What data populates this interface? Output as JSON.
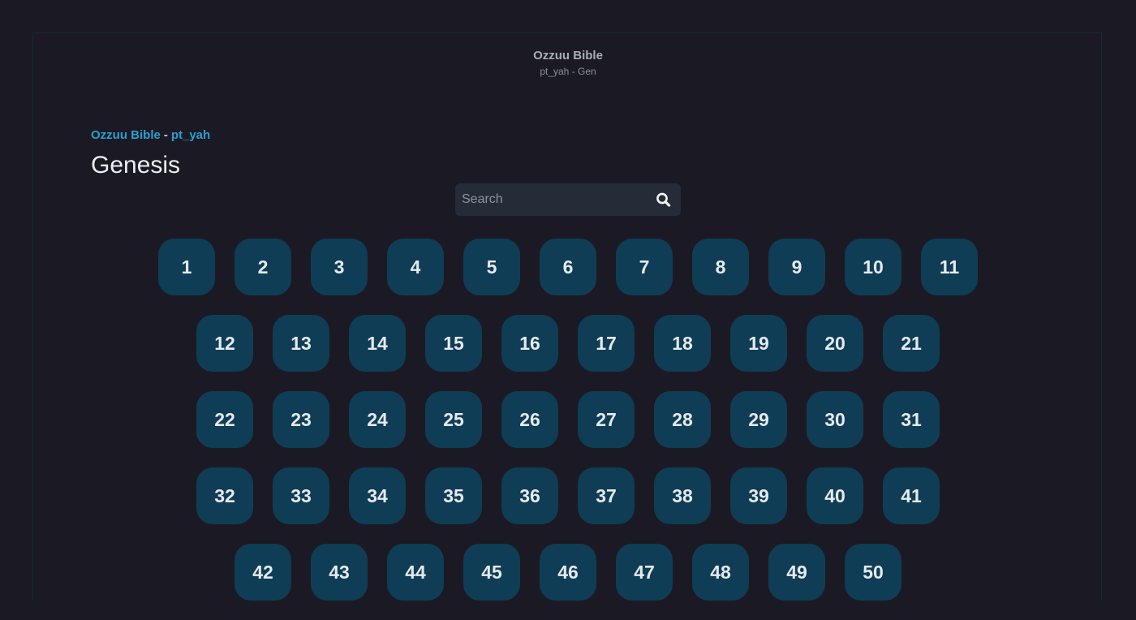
{
  "header": {
    "site_title": "Ozzuu Bible",
    "site_subtitle": "pt_yah - Gen"
  },
  "breadcrumb": {
    "home_label": "Ozzuu Bible",
    "separator": "-",
    "translation_label": "pt_yah"
  },
  "book": {
    "title": "Genesis"
  },
  "search": {
    "placeholder": "Search",
    "value": "",
    "icon": "search-icon"
  },
  "chapters": {
    "rows": [
      [
        "1",
        "2",
        "3",
        "4",
        "5",
        "6",
        "7",
        "8",
        "9",
        "10",
        "11"
      ],
      [
        "12",
        "13",
        "14",
        "15",
        "16",
        "17",
        "18",
        "19",
        "20",
        "21"
      ],
      [
        "22",
        "23",
        "24",
        "25",
        "26",
        "27",
        "28",
        "29",
        "30",
        "31"
      ],
      [
        "32",
        "33",
        "34",
        "35",
        "36",
        "37",
        "38",
        "39",
        "40",
        "41"
      ],
      [
        "42",
        "43",
        "44",
        "45",
        "46",
        "47",
        "48",
        "49",
        "50"
      ]
    ]
  },
  "colors": {
    "background": "#1b1a24",
    "chapter_button": "#0f3d55",
    "link_accent": "#2b9fd0",
    "search_background": "#262c37"
  }
}
